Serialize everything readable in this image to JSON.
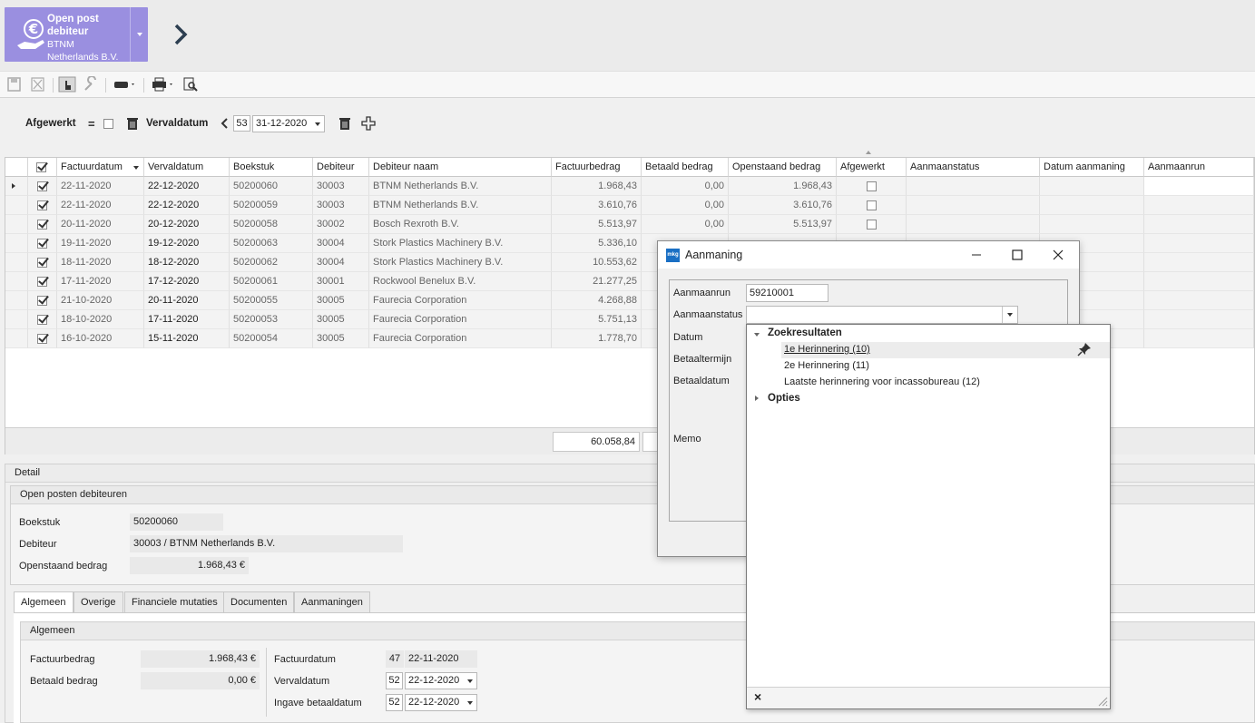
{
  "app": {
    "title": "Open post debiteur",
    "company": "BTNM Netherlands B.V."
  },
  "filter": {
    "afgewerkt_label": "Afgewerkt",
    "vervaldatum_label": "Vervaldatum",
    "week": "53",
    "date": "31-12-2020"
  },
  "grid": {
    "columns": [
      "Factuurdatum",
      "Vervaldatum",
      "Boekstuk",
      "Debiteur",
      "Debiteur naam",
      "Factuurbedrag",
      "Betaald bedrag",
      "Openstaand bedrag",
      "Afgewerkt",
      "Aanmaanstatus",
      "Datum aanmaning",
      "Aanmaanrun"
    ],
    "rows": [
      {
        "factuurdatum": "22-11-2020",
        "vervaldatum": "22-12-2020",
        "boekstuk": "50200060",
        "debiteur": "30003",
        "naam": "BTNM Netherlands B.V.",
        "factuurbedrag": "1.968,43",
        "betaald": "0,00",
        "openstaand": "1.968,43"
      },
      {
        "factuurdatum": "22-11-2020",
        "vervaldatum": "22-12-2020",
        "boekstuk": "50200059",
        "debiteur": "30003",
        "naam": "BTNM Netherlands B.V.",
        "factuurbedrag": "3.610,76",
        "betaald": "0,00",
        "openstaand": "3.610,76"
      },
      {
        "factuurdatum": "20-11-2020",
        "vervaldatum": "20-12-2020",
        "boekstuk": "50200058",
        "debiteur": "30002",
        "naam": "Bosch Rexroth B.V.",
        "factuurbedrag": "5.513,97",
        "betaald": "0,00",
        "openstaand": "5.513,97"
      },
      {
        "factuurdatum": "19-11-2020",
        "vervaldatum": "19-12-2020",
        "boekstuk": "50200063",
        "debiteur": "30004",
        "naam": "Stork Plastics Machinery B.V.",
        "factuurbedrag": "5.336,10",
        "betaald": "",
        "openstaand": ""
      },
      {
        "factuurdatum": "18-11-2020",
        "vervaldatum": "18-12-2020",
        "boekstuk": "50200062",
        "debiteur": "30004",
        "naam": "Stork Plastics Machinery B.V.",
        "factuurbedrag": "10.553,62",
        "betaald": "",
        "openstaand": ""
      },
      {
        "factuurdatum": "17-11-2020",
        "vervaldatum": "17-12-2020",
        "boekstuk": "50200061",
        "debiteur": "30001",
        "naam": "Rockwool Benelux B.V.",
        "factuurbedrag": "21.277,25",
        "betaald": "",
        "openstaand": ""
      },
      {
        "factuurdatum": "21-10-2020",
        "vervaldatum": "20-11-2020",
        "boekstuk": "50200055",
        "debiteur": "30005",
        "naam": "Faurecia Corporation",
        "factuurbedrag": "4.268,88",
        "betaald": "",
        "openstaand": ""
      },
      {
        "factuurdatum": "18-10-2020",
        "vervaldatum": "17-11-2020",
        "boekstuk": "50200053",
        "debiteur": "30005",
        "naam": "Faurecia Corporation",
        "factuurbedrag": "5.751,13",
        "betaald": "",
        "openstaand": ""
      },
      {
        "factuurdatum": "16-10-2020",
        "vervaldatum": "15-11-2020",
        "boekstuk": "50200054",
        "debiteur": "30005",
        "naam": "Faurecia Corporation",
        "factuurbedrag": "1.778,70",
        "betaald": "",
        "openstaand": ""
      }
    ],
    "total_factuurbedrag": "60.058,84"
  },
  "detail": {
    "section_label": "Detail",
    "panel_title": "Open posten debiteuren",
    "boekstuk_label": "Boekstuk",
    "boekstuk": "50200060",
    "debiteur_label": "Debiteur",
    "debiteur": "30003 / BTNM Netherlands B.V.",
    "openstaand_label": "Openstaand bedrag",
    "openstaand": "1.968,43 €",
    "tabs": [
      "Algemeen",
      "Overige",
      "Financiele mutaties",
      "Documenten",
      "Aanmaningen"
    ],
    "algemeen": {
      "title": "Algemeen",
      "factuurbedrag_label": "Factuurbedrag",
      "factuurbedrag": "1.968,43 €",
      "betaald_label": "Betaald bedrag",
      "betaald": "0,00 €",
      "factuurdatum_label": "Factuurdatum",
      "factuurdatum_week": "47",
      "factuurdatum": "22-11-2020",
      "vervaldatum_label": "Vervaldatum",
      "vervaldatum_week": "52",
      "vervaldatum": "22-12-2020",
      "ingave_label": "Ingave betaaldatum",
      "ingave_week": "52",
      "ingave": "22-12-2020"
    }
  },
  "dialog": {
    "icon_text": "mkg",
    "title": "Aanmaning",
    "aanmaanrun_label": "Aanmaanrun",
    "aanmaanrun": "59210001",
    "aanmaanstatus_label": "Aanmaanstatus",
    "aanmaanstatus": "",
    "datum_label": "Datum",
    "betaaltermijn_label": "Betaaltermijn",
    "betaaldatum_label": "Betaaldatum",
    "memo_label": "Memo"
  },
  "popup": {
    "group1": "Zoekresultaten",
    "items": [
      "1e Herinnering (10)",
      "2e Herinnering (11)",
      "Laatste herinnering voor incassobureau (12)"
    ],
    "group2": "Opties",
    "close_label": "×"
  }
}
